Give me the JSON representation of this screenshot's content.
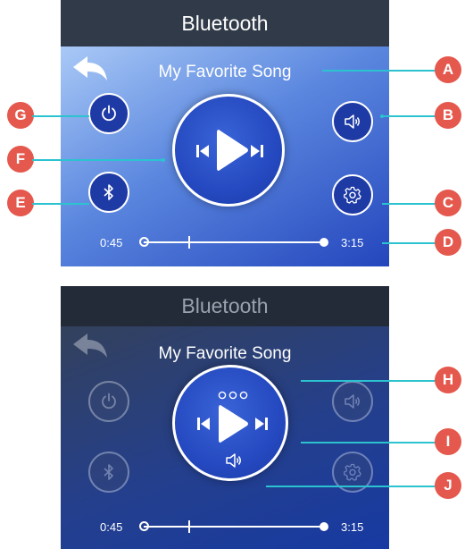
{
  "screens": [
    {
      "title": "Bluetooth",
      "song": "My Favorite Song",
      "elapsed": "0:45",
      "duration": "3:15",
      "progress": 0.23
    },
    {
      "title": "Bluetooth",
      "song": "My Favorite Song",
      "elapsed": "0:45",
      "duration": "3:15",
      "progress": 0.23
    }
  ],
  "callouts": [
    "A",
    "B",
    "C",
    "D",
    "E",
    "F",
    "G",
    "H",
    "I",
    "J"
  ],
  "icons": [
    "back-arrow-icon",
    "power-icon",
    "bluetooth-icon",
    "volume-icon",
    "gear-icon",
    "previous-icon",
    "play-icon",
    "next-icon",
    "more-dots-icon"
  ],
  "colors": {
    "callout_badge": "#e4584d",
    "callout_line": "#2bc3cf",
    "button_fill": "#1e3aa4",
    "title_bar": "#303a48"
  }
}
